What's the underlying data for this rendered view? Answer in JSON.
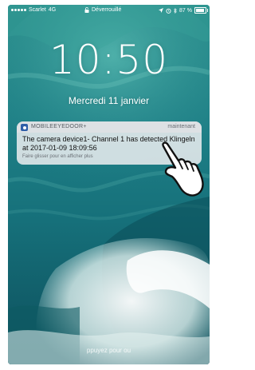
{
  "status_bar": {
    "carrier": "Scarlet",
    "network": "4G",
    "lock_status": "Déverrouillé",
    "battery_percent": "87 %",
    "battery_level": 0.87
  },
  "lock_screen": {
    "time": "10:50",
    "date": "Mercredi 11 janvier",
    "bottom_hint": "ppuyez pour ou"
  },
  "notification": {
    "app_name": "MOBILEEYEDOOR+",
    "time": "maintenant",
    "message": "The camera device1- Channel 1 has detected Klingeln at 2017-01-09 18:09:56",
    "hint": "Faire glisser pour en afficher plus"
  },
  "colors": {
    "sea_deep": "#0e5b68",
    "sea_mid": "#1f8c8f",
    "foam": "#e8f3f1",
    "notification_bg": "#eceef0"
  }
}
